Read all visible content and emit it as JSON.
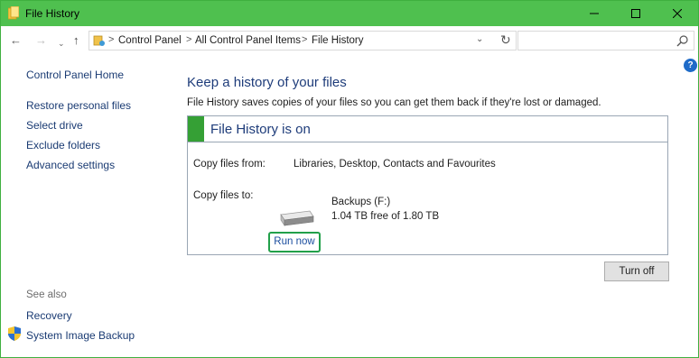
{
  "window": {
    "title": "File History",
    "controls": {
      "minimize": "—",
      "maximize": "☐",
      "close": "✕"
    }
  },
  "nav": {
    "back": "←",
    "forward": "→",
    "recent": "⌄",
    "up": "↑",
    "breadcrumb": [
      "Control Panel",
      "All Control Panel Items",
      "File History"
    ],
    "separator": ">",
    "dropdown": "⌄",
    "refresh": "↻",
    "search_placeholder": ""
  },
  "sidebar": {
    "home": "Control Panel Home",
    "items": [
      "Restore personal files",
      "Select drive",
      "Exclude folders",
      "Advanced settings"
    ],
    "see_also_label": "See also",
    "see_also": [
      "Recovery",
      "System Image Backup"
    ]
  },
  "main": {
    "title": "Keep a history of your files",
    "description": "File History saves copies of your files so you can get them back if they're lost or damaged.",
    "status": {
      "text": "File History is on",
      "color": "#35a035"
    },
    "copy_from_label": "Copy files from:",
    "copy_from_value": "Libraries, Desktop, Contacts and Favourites",
    "copy_to_label": "Copy files to:",
    "drive_name": "Backups (F:)",
    "drive_space": "1.04 TB free of 1.80 TB",
    "run_now": "Run now",
    "turn_off": "Turn off"
  },
  "help": "?",
  "colors": {
    "titlebar": "#4fc04f",
    "link": "#1a3b73",
    "heading": "#1e3c7a",
    "highlight": "#22a04a"
  }
}
